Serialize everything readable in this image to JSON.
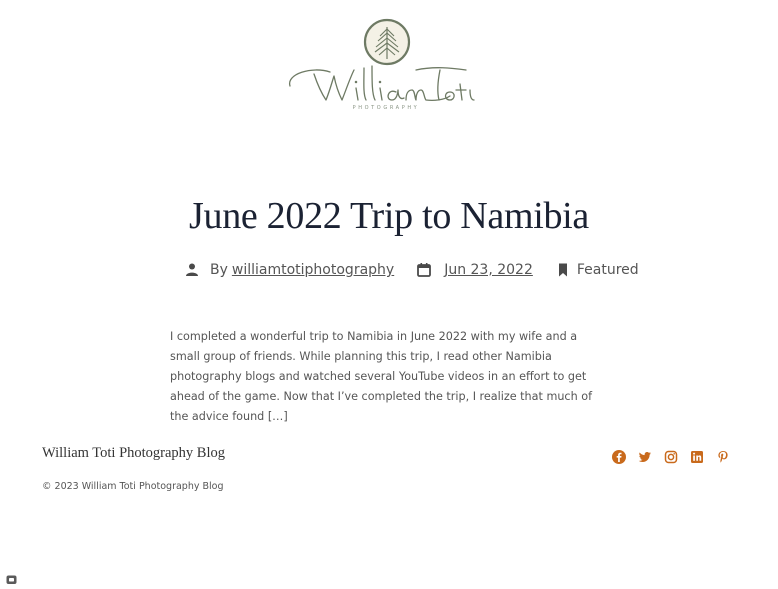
{
  "brand": {
    "logo_sub": "PHOTOGRAPHY",
    "logo_color": "#6e7a64"
  },
  "post": {
    "title": "June 2022 Trip to Namibia",
    "author_prefix": "By",
    "author": "williamtotiphotography",
    "date": "Jun 23, 2022",
    "category": "Featured",
    "excerpt": "I completed a wonderful trip to Namibia in June 2022 with my wife and a small group of friends.  While planning this trip, I read other Namibia photography blogs and watched several YouTube videos in an effort to get ahead of the game.  Now that I’ve completed the trip, I realize that much of the advice found […]"
  },
  "footer": {
    "site_title": "William Toti Photography Blog",
    "copyright": "© 2023  William Toti Photography Blog",
    "social_color": "#c96a1c",
    "social": [
      {
        "icon": "facebook-icon"
      },
      {
        "icon": "twitter-icon"
      },
      {
        "icon": "instagram-icon"
      },
      {
        "icon": "linkedin-icon"
      },
      {
        "icon": "pinterest-icon"
      }
    ]
  },
  "icons": {
    "author": "person-icon",
    "date": "calendar-icon",
    "category": "bookmark-icon"
  }
}
